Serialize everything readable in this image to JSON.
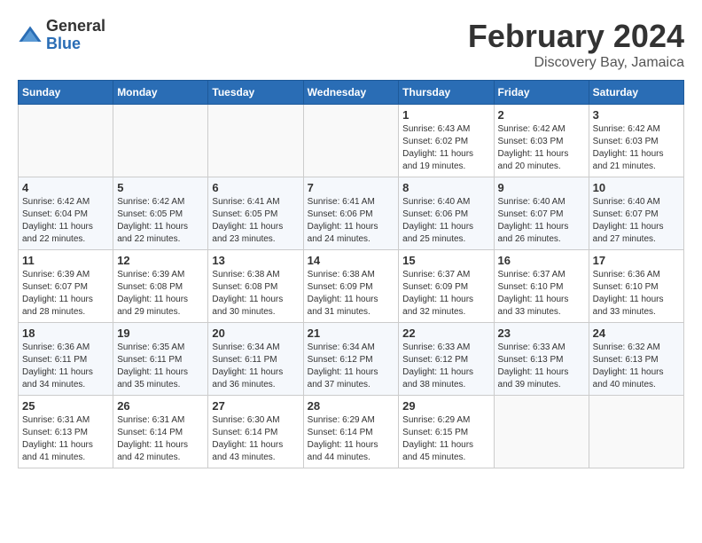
{
  "logo": {
    "general": "General",
    "blue": "Blue"
  },
  "header": {
    "month": "February 2024",
    "location": "Discovery Bay, Jamaica"
  },
  "days_of_week": [
    "Sunday",
    "Monday",
    "Tuesday",
    "Wednesday",
    "Thursday",
    "Friday",
    "Saturday"
  ],
  "weeks": [
    [
      {
        "day": "",
        "info": ""
      },
      {
        "day": "",
        "info": ""
      },
      {
        "day": "",
        "info": ""
      },
      {
        "day": "",
        "info": ""
      },
      {
        "day": "1",
        "info": "Sunrise: 6:43 AM\nSunset: 6:02 PM\nDaylight: 11 hours and 19 minutes."
      },
      {
        "day": "2",
        "info": "Sunrise: 6:42 AM\nSunset: 6:03 PM\nDaylight: 11 hours and 20 minutes."
      },
      {
        "day": "3",
        "info": "Sunrise: 6:42 AM\nSunset: 6:03 PM\nDaylight: 11 hours and 21 minutes."
      }
    ],
    [
      {
        "day": "4",
        "info": "Sunrise: 6:42 AM\nSunset: 6:04 PM\nDaylight: 11 hours and 22 minutes."
      },
      {
        "day": "5",
        "info": "Sunrise: 6:42 AM\nSunset: 6:05 PM\nDaylight: 11 hours and 22 minutes."
      },
      {
        "day": "6",
        "info": "Sunrise: 6:41 AM\nSunset: 6:05 PM\nDaylight: 11 hours and 23 minutes."
      },
      {
        "day": "7",
        "info": "Sunrise: 6:41 AM\nSunset: 6:06 PM\nDaylight: 11 hours and 24 minutes."
      },
      {
        "day": "8",
        "info": "Sunrise: 6:40 AM\nSunset: 6:06 PM\nDaylight: 11 hours and 25 minutes."
      },
      {
        "day": "9",
        "info": "Sunrise: 6:40 AM\nSunset: 6:07 PM\nDaylight: 11 hours and 26 minutes."
      },
      {
        "day": "10",
        "info": "Sunrise: 6:40 AM\nSunset: 6:07 PM\nDaylight: 11 hours and 27 minutes."
      }
    ],
    [
      {
        "day": "11",
        "info": "Sunrise: 6:39 AM\nSunset: 6:07 PM\nDaylight: 11 hours and 28 minutes."
      },
      {
        "day": "12",
        "info": "Sunrise: 6:39 AM\nSunset: 6:08 PM\nDaylight: 11 hours and 29 minutes."
      },
      {
        "day": "13",
        "info": "Sunrise: 6:38 AM\nSunset: 6:08 PM\nDaylight: 11 hours and 30 minutes."
      },
      {
        "day": "14",
        "info": "Sunrise: 6:38 AM\nSunset: 6:09 PM\nDaylight: 11 hours and 31 minutes."
      },
      {
        "day": "15",
        "info": "Sunrise: 6:37 AM\nSunset: 6:09 PM\nDaylight: 11 hours and 32 minutes."
      },
      {
        "day": "16",
        "info": "Sunrise: 6:37 AM\nSunset: 6:10 PM\nDaylight: 11 hours and 33 minutes."
      },
      {
        "day": "17",
        "info": "Sunrise: 6:36 AM\nSunset: 6:10 PM\nDaylight: 11 hours and 33 minutes."
      }
    ],
    [
      {
        "day": "18",
        "info": "Sunrise: 6:36 AM\nSunset: 6:11 PM\nDaylight: 11 hours and 34 minutes."
      },
      {
        "day": "19",
        "info": "Sunrise: 6:35 AM\nSunset: 6:11 PM\nDaylight: 11 hours and 35 minutes."
      },
      {
        "day": "20",
        "info": "Sunrise: 6:34 AM\nSunset: 6:11 PM\nDaylight: 11 hours and 36 minutes."
      },
      {
        "day": "21",
        "info": "Sunrise: 6:34 AM\nSunset: 6:12 PM\nDaylight: 11 hours and 37 minutes."
      },
      {
        "day": "22",
        "info": "Sunrise: 6:33 AM\nSunset: 6:12 PM\nDaylight: 11 hours and 38 minutes."
      },
      {
        "day": "23",
        "info": "Sunrise: 6:33 AM\nSunset: 6:13 PM\nDaylight: 11 hours and 39 minutes."
      },
      {
        "day": "24",
        "info": "Sunrise: 6:32 AM\nSunset: 6:13 PM\nDaylight: 11 hours and 40 minutes."
      }
    ],
    [
      {
        "day": "25",
        "info": "Sunrise: 6:31 AM\nSunset: 6:13 PM\nDaylight: 11 hours and 41 minutes."
      },
      {
        "day": "26",
        "info": "Sunrise: 6:31 AM\nSunset: 6:14 PM\nDaylight: 11 hours and 42 minutes."
      },
      {
        "day": "27",
        "info": "Sunrise: 6:30 AM\nSunset: 6:14 PM\nDaylight: 11 hours and 43 minutes."
      },
      {
        "day": "28",
        "info": "Sunrise: 6:29 AM\nSunset: 6:14 PM\nDaylight: 11 hours and 44 minutes."
      },
      {
        "day": "29",
        "info": "Sunrise: 6:29 AM\nSunset: 6:15 PM\nDaylight: 11 hours and 45 minutes."
      },
      {
        "day": "",
        "info": ""
      },
      {
        "day": "",
        "info": ""
      }
    ]
  ]
}
